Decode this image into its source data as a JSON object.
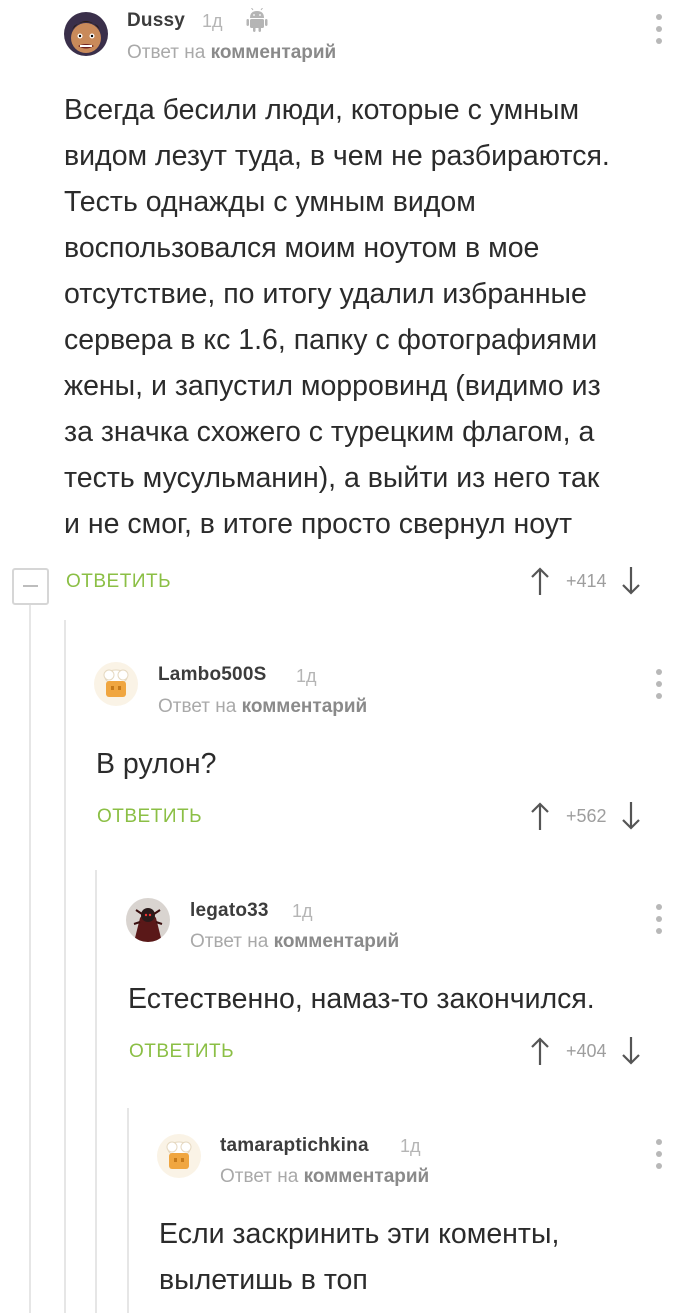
{
  "comments": [
    {
      "username": "Dussy",
      "age": "1д",
      "reply_prefix": "Ответ на",
      "reply_target": "комментарий",
      "text_lines": [
        "Всегда бесили люди, которые с умным",
        "видом лезут туда, в чем не разбираются.",
        "Тесть однажды с умным видом",
        "воспользовался моим ноутом в мое",
        "отсутствие, по итогу удалил избранные",
        "сервера в кс 1.6, папку с фотографиями",
        "жены, и запустил морровинд (видимо из",
        "за значка схожего с турецким флагом, а",
        "тесть мусульманин), а выйти из него так",
        "и не смог, в итоге просто свернул ноут"
      ],
      "reply_label": "ОТВЕТИТЬ",
      "rating": "+414",
      "platform_icon": "android-icon"
    },
    {
      "username": "Lambo500S",
      "age": "1д",
      "reply_prefix": "Ответ на",
      "reply_target": "комментарий",
      "text_lines": [
        "В рулон?"
      ],
      "reply_label": "ОТВЕТИТЬ",
      "rating": "+562"
    },
    {
      "username": "legato33",
      "age": "1д",
      "reply_prefix": "Ответ на",
      "reply_target": "комментарий",
      "text_lines": [
        "Естественно, намаз-то закончился."
      ],
      "reply_label": "ОТВЕТИТЬ",
      "rating": "+404"
    },
    {
      "username": "tamaraptichkina",
      "age": "1д",
      "reply_prefix": "Ответ на",
      "reply_target": "комментарий",
      "text_lines": [
        "Если заскринить эти коменты,",
        "вылетишь в топ"
      ]
    }
  ],
  "colors": {
    "reply_green": "#8bbf45",
    "muted_gray": "#a9a9a9",
    "thread_line": "#e6e6e6"
  }
}
